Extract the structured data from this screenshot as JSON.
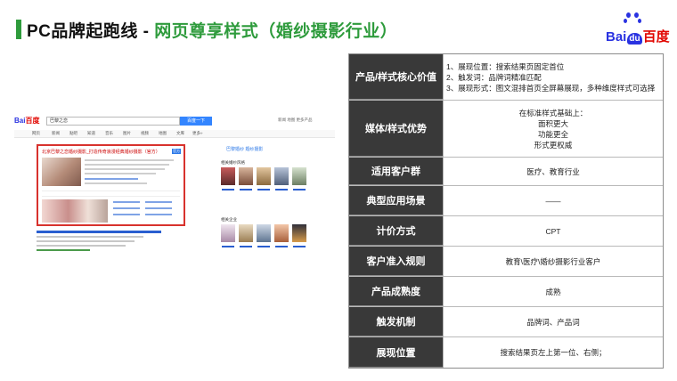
{
  "title": {
    "prefix": "PC品牌起跑线 - ",
    "highlight": "网页尊享样式（婚纱摄影行业）"
  },
  "logo": {
    "text_left": "Bai",
    "text_du": "du",
    "text_right": "百度"
  },
  "screenshot": {
    "logo": {
      "left": "Bai",
      "right": "百度"
    },
    "search_query": "巴黎之恋",
    "search_button": "百度一下",
    "top_links": "新闻 地图 更多产品",
    "tabs": [
      "网页",
      "新闻",
      "贴吧",
      "知道",
      "音乐",
      "图片",
      "视频",
      "地图",
      "文库",
      "更多»"
    ],
    "ad_title": "北京巴黎之恋婚纱摄影_打造传奇浪漫经典婚纱摄影（官方）",
    "ad_tag": "官方",
    "side_title": "巴黎婚纱 婚纱摄影",
    "side_sub_1": "相关婚纱风格",
    "side_sub_2": "相关企业"
  },
  "table": {
    "rows": [
      {
        "header": "产品/样式核心价值",
        "align": "left",
        "lines": [
          "1、展现位置：搜索结果页固定首位",
          "2、触发词：品牌词精准匹配",
          "3、展现形式：图文混排首页全屏幕展现，多种维度样式可选择"
        ]
      },
      {
        "header": "媒体/样式优势",
        "align": "center",
        "lines": [
          "在标准样式基础上：",
          "面积更大",
          "功能更全",
          "形式更权威"
        ]
      },
      {
        "header": "适用客户群",
        "align": "center",
        "lines": [
          "医疗、教育行业"
        ]
      },
      {
        "header": "典型应用场景",
        "align": "center",
        "lines": [
          "——"
        ]
      },
      {
        "header": "计价方式",
        "align": "center",
        "lines": [
          "CPT"
        ]
      },
      {
        "header": "客户准入规则",
        "align": "center",
        "lines": [
          "教育\\医疗\\婚纱摄影行业客户"
        ]
      },
      {
        "header": "产品成熟度",
        "align": "center",
        "lines": [
          "成熟"
        ]
      },
      {
        "header": "触发机制",
        "align": "center",
        "lines": [
          "品牌词、产品词"
        ]
      },
      {
        "header": "展现位置",
        "align": "center",
        "lines": [
          "搜索结果页左上第一位、右侧；"
        ]
      }
    ]
  },
  "colors": {
    "accent_green": "#2e9b3c",
    "header_bg": "#393939",
    "baidu_blue": "#2932e1",
    "baidu_red": "#e10601",
    "ad_border": "#d8322d"
  }
}
